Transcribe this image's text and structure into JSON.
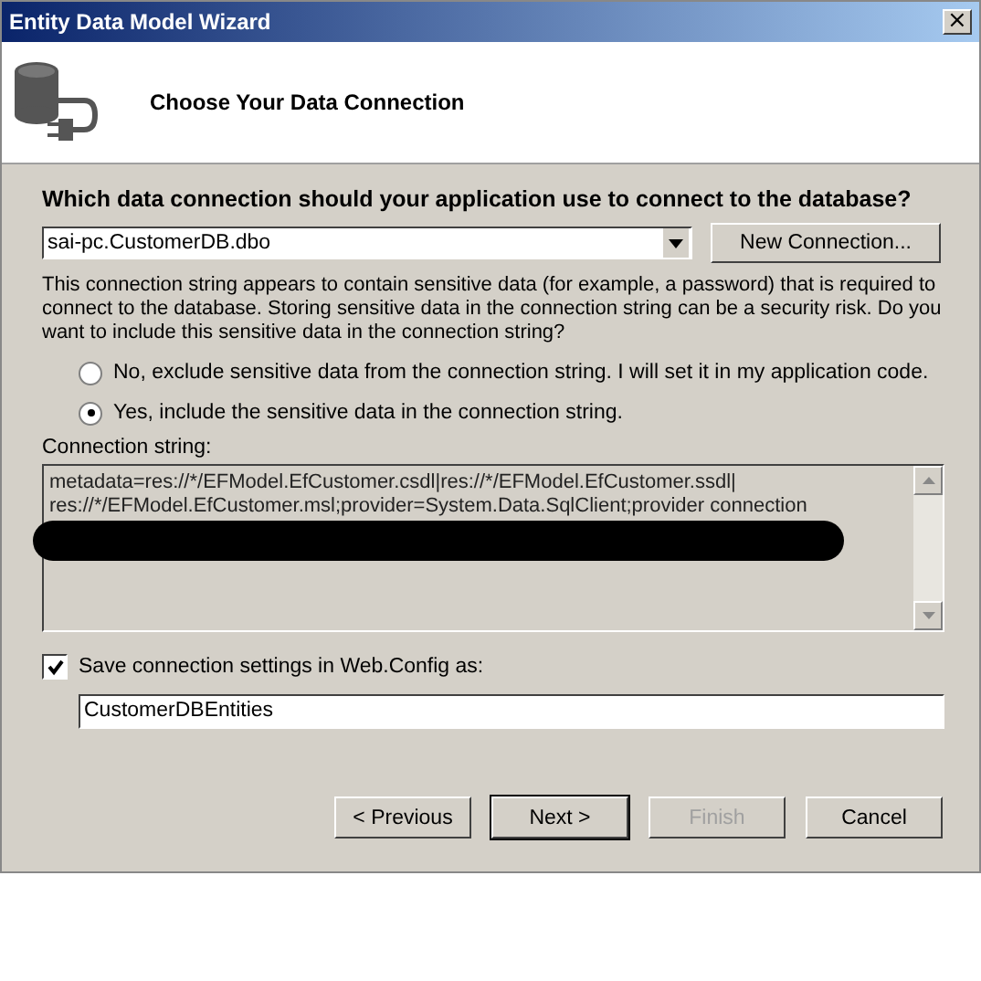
{
  "window": {
    "title": "Entity Data Model Wizard",
    "close": "×"
  },
  "header": {
    "title": "Choose Your Data Connection"
  },
  "question": "Which data connection should your application use to connect to the database?",
  "connection_dropdown": {
    "value": "sai-pc.CustomerDB.dbo"
  },
  "new_connection_button": "New Connection...",
  "warning": "This connection string appears to contain sensitive data (for example, a password) that is required to connect to the database. Storing sensitive data in the connection string can be a security risk. Do you want to include this sensitive data in the connection string?",
  "options": [
    {
      "label": "No, exclude sensitive data from the connection string. I will set it in my application code.",
      "selected": false
    },
    {
      "label": "Yes, include the sensitive data in the connection string.",
      "selected": true
    }
  ],
  "connection_string": {
    "label": "Connection string:",
    "lines": [
      "metadata=res://*/EFModel.EfCustomer.csdl|res://*/EFModel.EfCustomer.ssdl|",
      "res://*/EFModel.EfCustomer.msl;provider=System.Data.SqlClient;provider connection"
    ],
    "redacted": true
  },
  "save_setting": {
    "label": "Save connection settings in Web.Config as:",
    "checked": true,
    "value": "CustomerDBEntities"
  },
  "buttons": [
    {
      "label": "< Previous",
      "default": false,
      "disabled": false
    },
    {
      "label": "Next >",
      "default": true,
      "disabled": false
    },
    {
      "label": "Finish",
      "default": false,
      "disabled": true
    },
    {
      "label": "Cancel",
      "default": false,
      "disabled": false
    }
  ]
}
